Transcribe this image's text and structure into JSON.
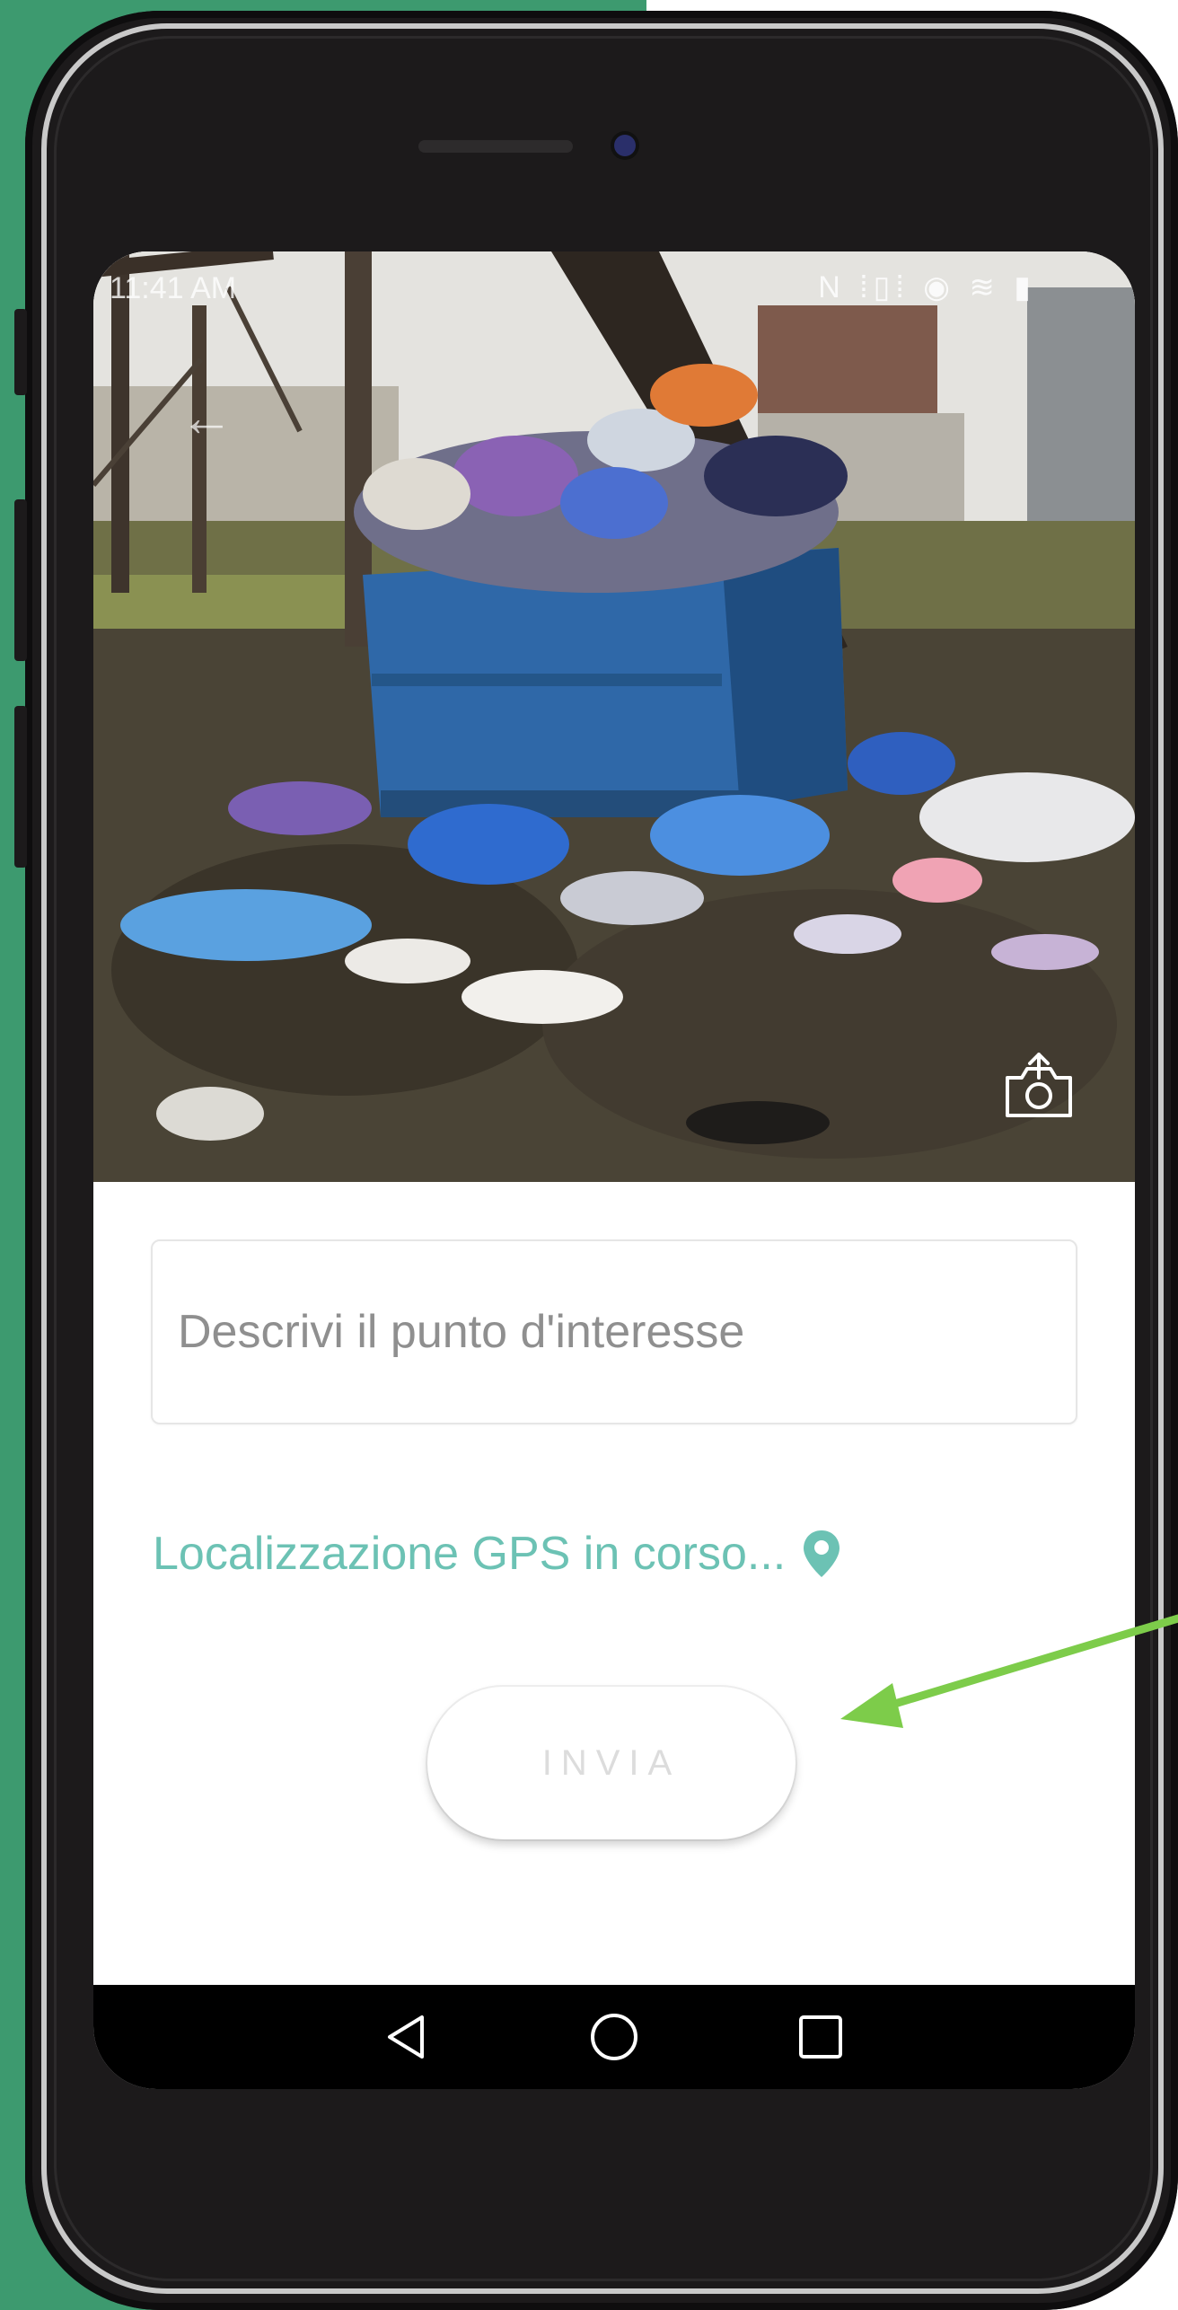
{
  "status_bar": {
    "time": "11:41 AM",
    "icons": "N  ⁞▯⁞  ◉  ≋  ▮"
  },
  "photo": {
    "subject": "overflowing-dumpster-photo",
    "camera_button_icon": "camera-icon"
  },
  "form": {
    "description_placeholder": "Descrivi il punto d'interesse",
    "description_value": "",
    "gps_status": "Localizzazione GPS in corso...",
    "gps_icon": "map-pin-icon",
    "gps_color": "#6cc2b4",
    "send_label": "INVIA"
  },
  "nav": {
    "back_icon": "nav-back-icon",
    "home_icon": "nav-home-icon",
    "recents_icon": "nav-recents-icon"
  },
  "colors": {
    "background_green": "#3d9a6f",
    "phone_body": "#1c1a1b",
    "annotation_arrow": "#7dcc4a"
  }
}
